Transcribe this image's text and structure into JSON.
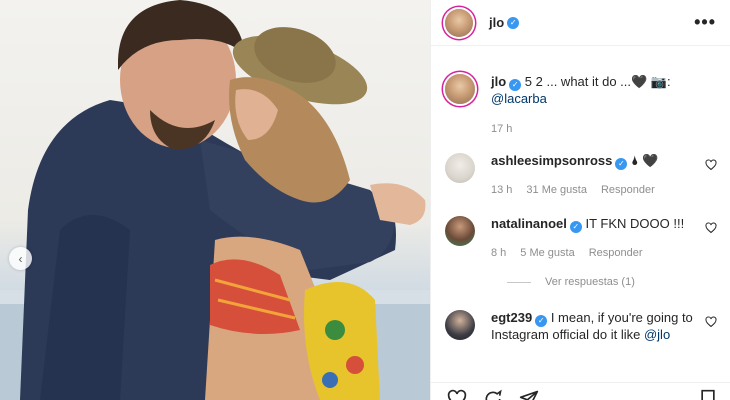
{
  "photo": {
    "description_icon": "photo-kiss",
    "nav_prev": "‹"
  },
  "header": {
    "username": "jlo",
    "more": "•••"
  },
  "caption": {
    "username": "jlo",
    "text": "5 2 ... what it do ...🖤 📷:",
    "mention": "@lacarba",
    "time": "17 h"
  },
  "comments": [
    {
      "username": "ashleesimpsonross",
      "verified": true,
      "text": "🌢 🖤",
      "time": "13 h",
      "likes": "31 Me gusta",
      "reply": "Responder"
    },
    {
      "username": "natalinanoel",
      "verified": true,
      "text": "IT FKN DOOO !!!",
      "time": "8 h",
      "likes": "5 Me gusta",
      "reply": "Responder",
      "view_replies": "Ver respuestas (1)"
    },
    {
      "username": "egt239",
      "verified": true,
      "text": "I mean, if you're going to Instagram official do it like",
      "mention": "@jlo"
    }
  ],
  "colors": {
    "verified": "#3897f0",
    "ring": "#d6249f",
    "muted": "#8e8e8e",
    "text": "#262626"
  }
}
